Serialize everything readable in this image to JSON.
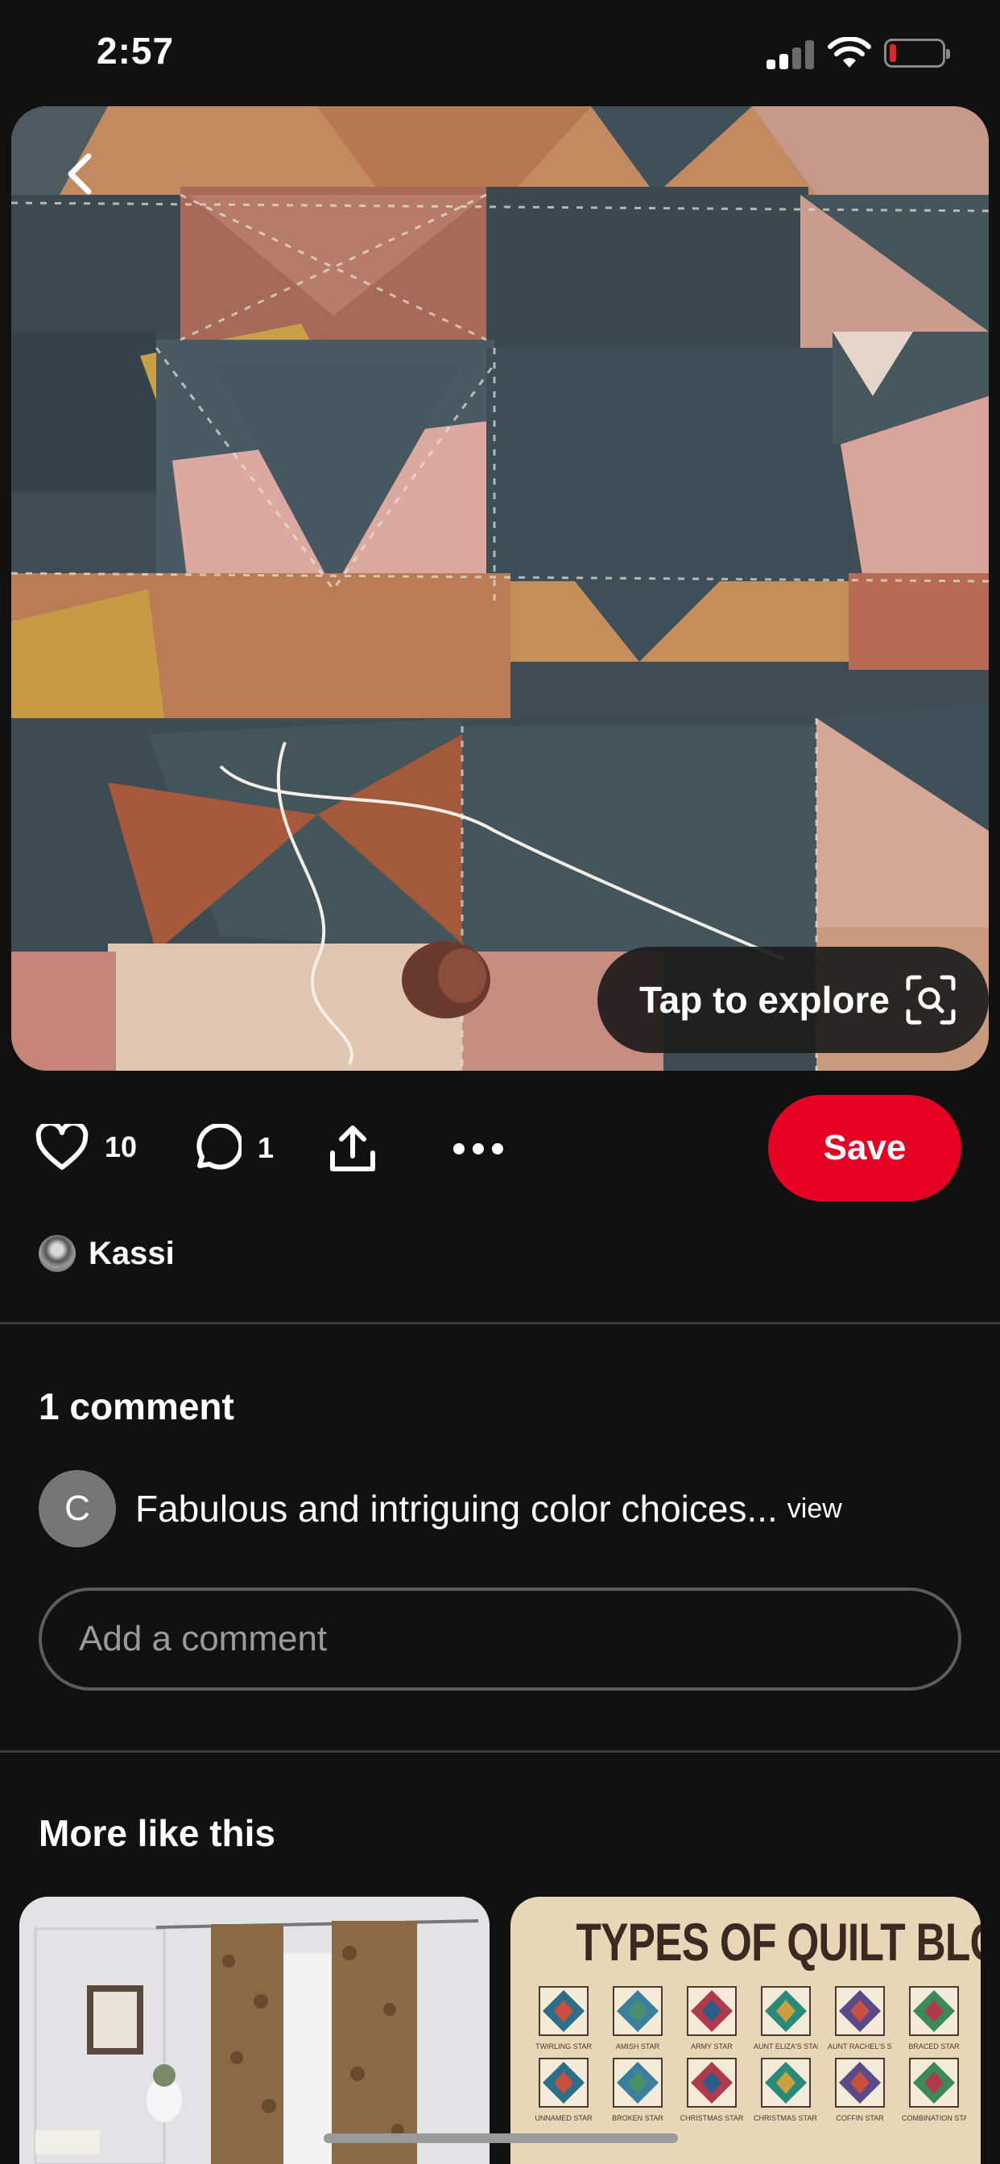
{
  "status_bar": {
    "time": "2:57"
  },
  "pin": {
    "explore_label": "Tap to explore",
    "likes": "10",
    "comments_count": "1",
    "save_label": "Save",
    "author": "Kassi"
  },
  "comments": {
    "title": "1 comment",
    "items": [
      {
        "avatar_letter": "C",
        "text": "Fabulous and intriguing color choices...",
        "view_label": "view"
      }
    ],
    "input_placeholder": "Add a comment"
  },
  "more": {
    "title": "More like this",
    "pins": [
      {
        "kind": "curtains-photo"
      },
      {
        "kind": "quilt-chart",
        "title": "TYPES OF QUILT BLOCKS",
        "blocks": [
          "TWIRLING STAR",
          "AMISH STAR",
          "ARMY STAR",
          "AUNT ELIZA'S STAR",
          "AUNT RACHEL'S STAR",
          "BRACED STAR",
          "UNNAMED STAR",
          "BROKEN STAR",
          "CHRISTMAS STAR",
          "CHRISTMAS STAR II",
          "COFFIN STAR",
          "COMBINATION STAR"
        ]
      }
    ]
  },
  "colors": {
    "save": "#e60023",
    "background": "#111111"
  }
}
